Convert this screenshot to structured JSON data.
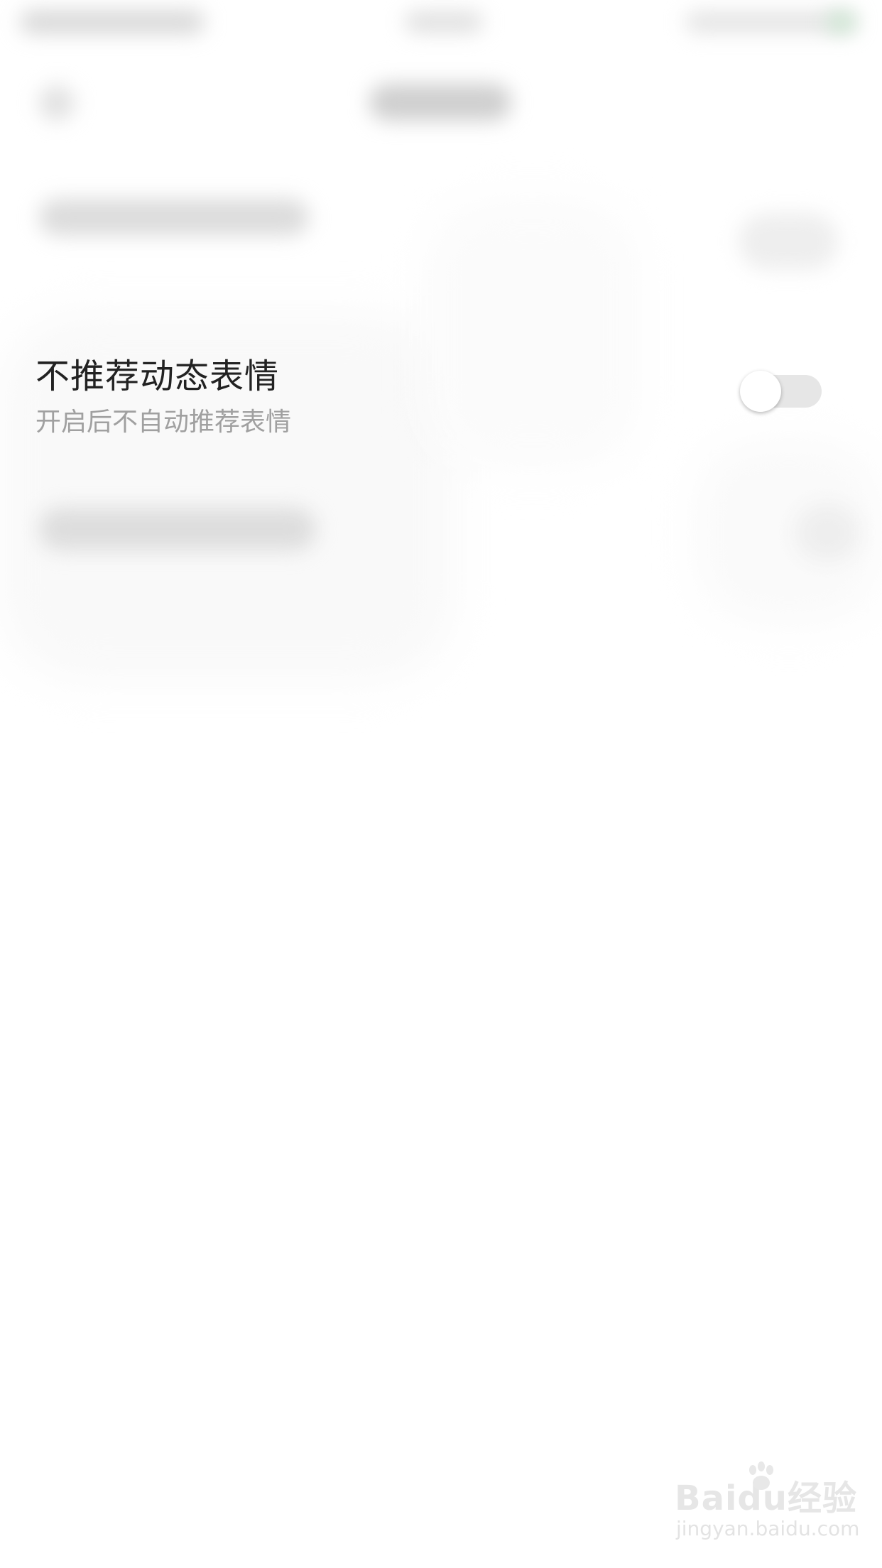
{
  "setting": {
    "title": "不推荐动态表情",
    "subtitle": "开启后不自动推荐表情",
    "toggle_on": false
  },
  "colors": {
    "title_text": "#222222",
    "subtitle_text": "#a0a0a0",
    "toggle_track_off": "#e6e6e6",
    "toggle_knob": "#ffffff",
    "background": "#ffffff"
  },
  "watermark": {
    "brand": "Baidu经验",
    "url": "jingyan.baidu.com"
  }
}
